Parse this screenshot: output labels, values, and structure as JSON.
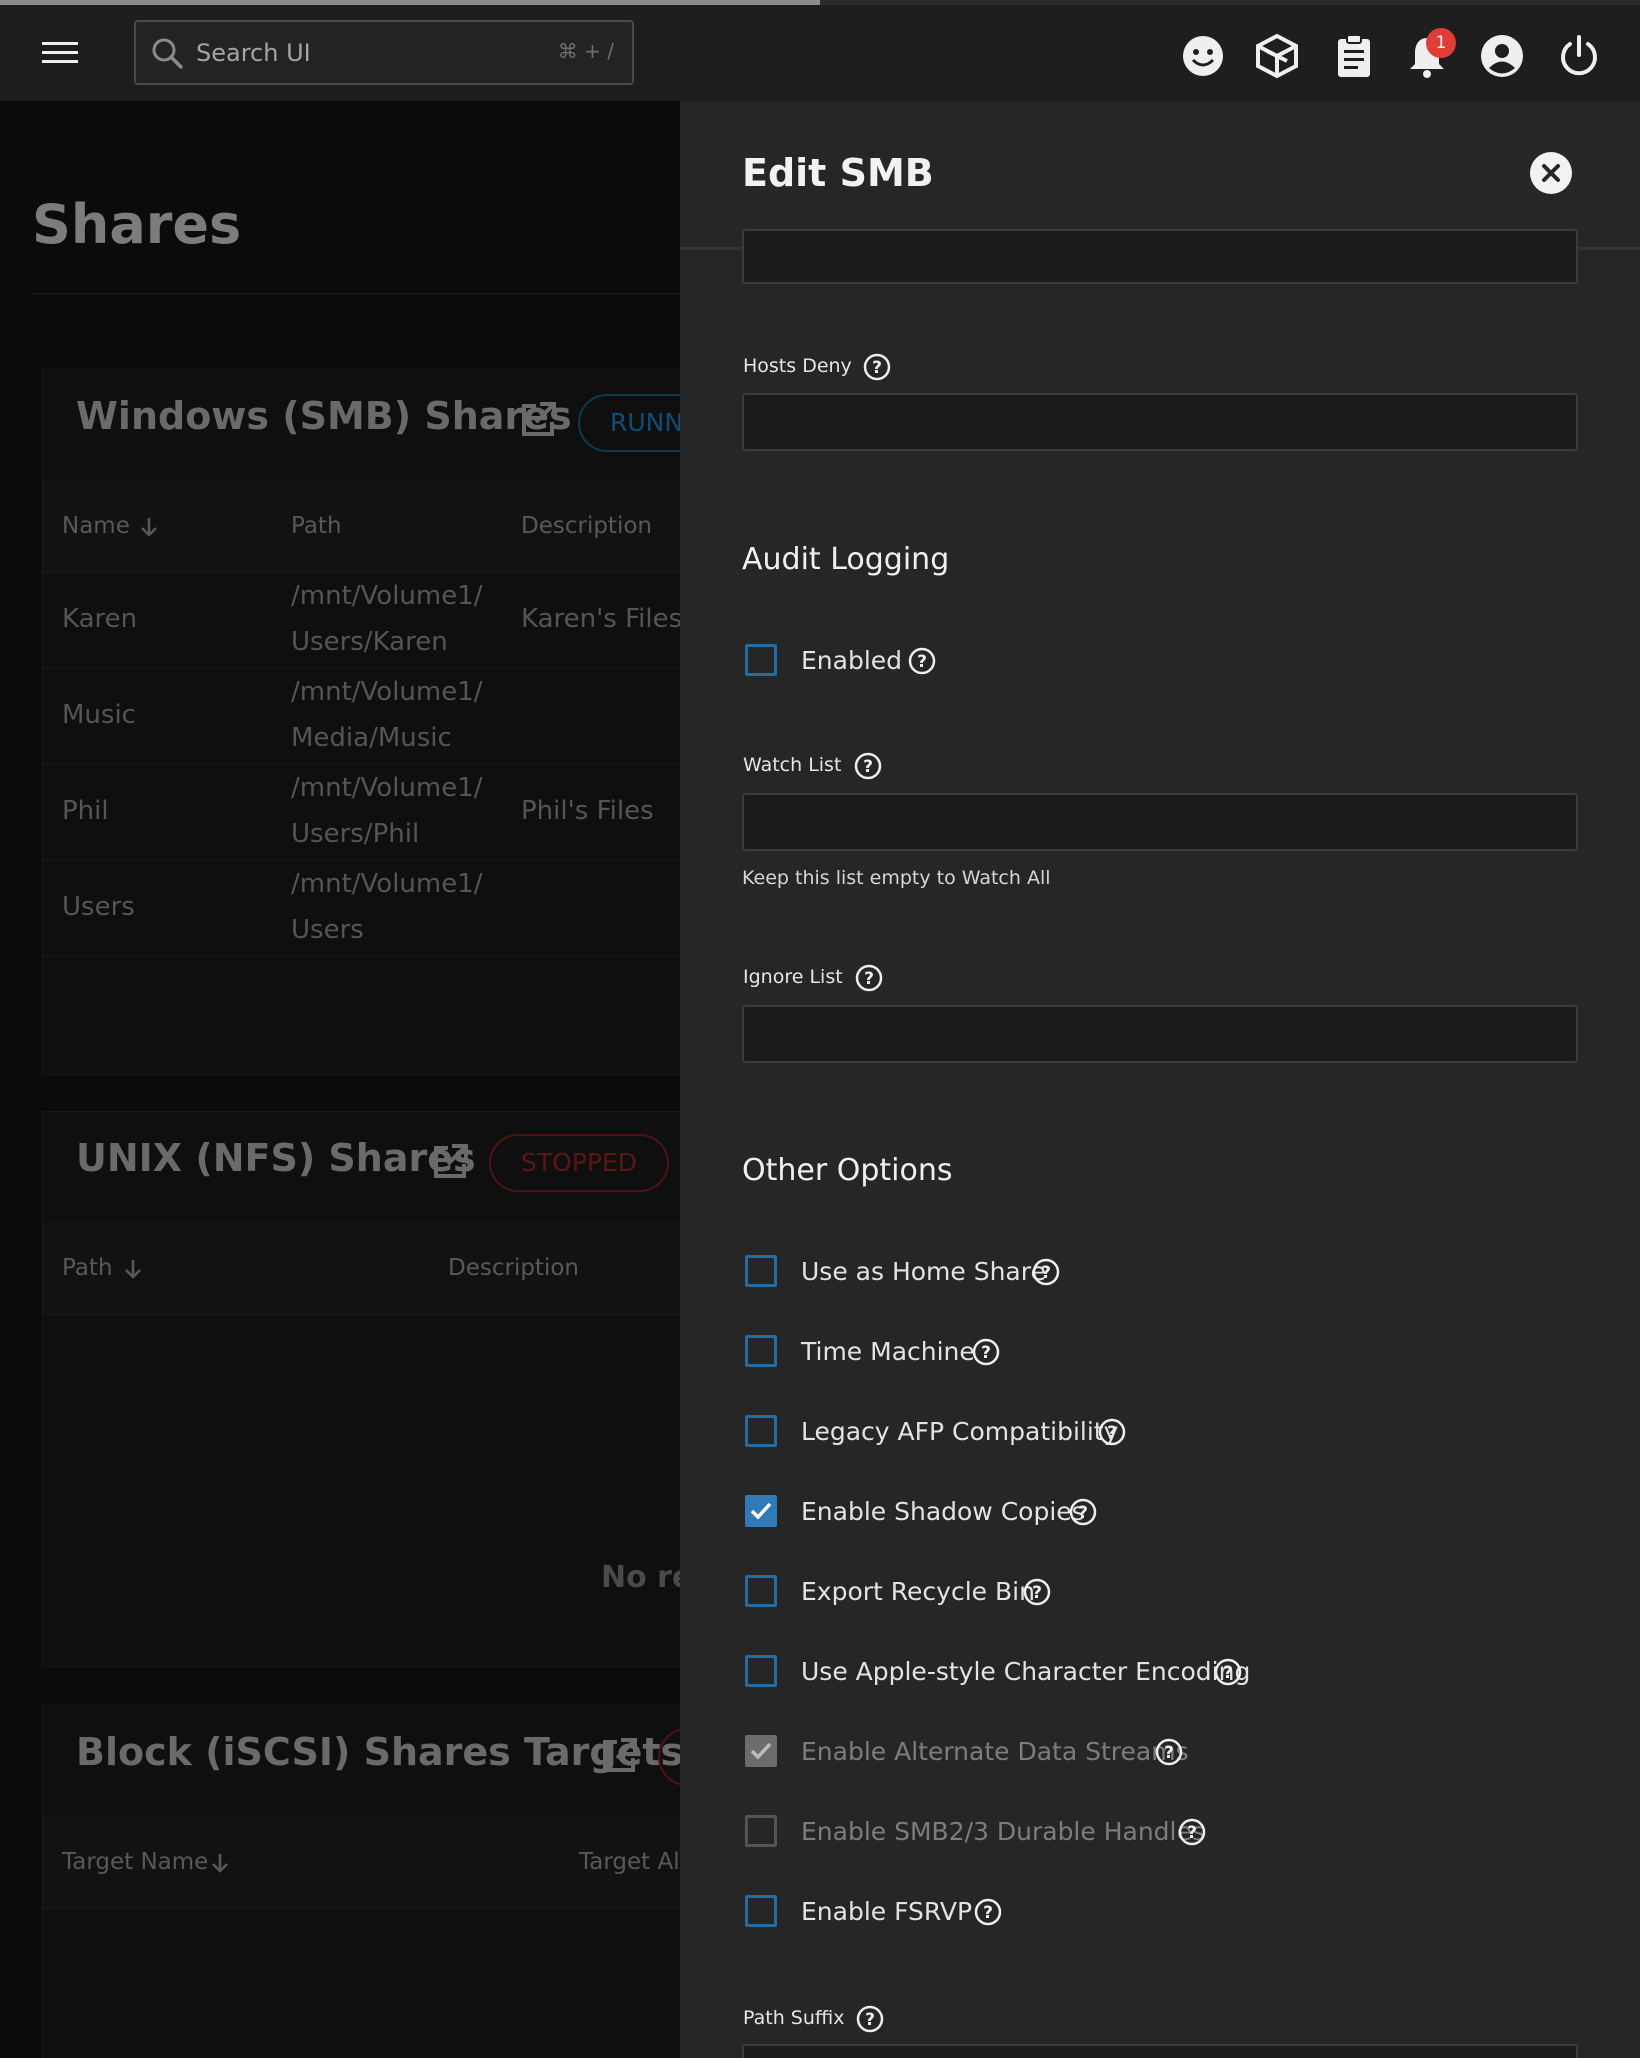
{
  "topbar": {
    "search_placeholder": "Search UI",
    "search_shortcut": "⌘ + /",
    "notification_count": "1",
    "icons": [
      "menu-icon",
      "search-icon",
      "smiley-icon",
      "truenas-logo-icon",
      "clipboard-icon",
      "bell-icon",
      "account-icon",
      "power-icon"
    ]
  },
  "background": {
    "page_title": "Shares",
    "smb": {
      "title": "Windows (SMB) Shares",
      "status": "RUNNING",
      "columns": [
        "Name",
        "Path",
        "Description"
      ],
      "rows": [
        {
          "name": "Karen",
          "path1": "/mnt/Volume1/",
          "path2": "Users/Karen",
          "description": "Karen's Files"
        },
        {
          "name": "Music",
          "path1": "/mnt/Volume1/",
          "path2": "Media/Music",
          "description": ""
        },
        {
          "name": "Phil",
          "path1": "/mnt/Volume1/",
          "path2": "Users/Phil",
          "description": "Phil's Files"
        },
        {
          "name": "Users",
          "path1": "/mnt/Volume1/",
          "path2": "Users",
          "description": ""
        }
      ]
    },
    "nfs": {
      "title": "UNIX (NFS) Shares",
      "status": "STOPPED",
      "columns": [
        "Path",
        "Description"
      ],
      "empty_text": "No records"
    },
    "iscsi": {
      "title": "Block (iSCSI) Shares Targets",
      "columns": [
        "Target Name",
        "Target Alias"
      ]
    }
  },
  "drawer": {
    "title": "Edit SMB",
    "hosts_deny": {
      "label": "Hosts Deny",
      "value": ""
    },
    "audit_section": "Audit Logging",
    "audit_enabled": {
      "label": "Enabled",
      "checked": false
    },
    "watch_list": {
      "label": "Watch List",
      "value": "",
      "hint": "Keep this list empty to Watch All"
    },
    "ignore_list": {
      "label": "Ignore List",
      "value": ""
    },
    "other_section": "Other Options",
    "options": [
      {
        "label": "Use as Home Share",
        "checked": false,
        "disabled": false
      },
      {
        "label": "Time Machine",
        "checked": false,
        "disabled": false
      },
      {
        "label": "Legacy AFP Compatibility",
        "checked": false,
        "disabled": false
      },
      {
        "label": "Enable Shadow Copies",
        "checked": true,
        "disabled": false
      },
      {
        "label": "Export Recycle Bin",
        "checked": false,
        "disabled": false
      },
      {
        "label": "Use Apple-style Character Encoding",
        "checked": false,
        "disabled": false
      },
      {
        "label": "Enable Alternate Data Streams",
        "checked": true,
        "disabled": true
      },
      {
        "label": "Enable SMB2/3 Durable Handles",
        "checked": false,
        "disabled": true
      },
      {
        "label": "Enable FSRVP",
        "checked": false,
        "disabled": false
      }
    ],
    "path_suffix": {
      "label": "Path Suffix"
    }
  }
}
